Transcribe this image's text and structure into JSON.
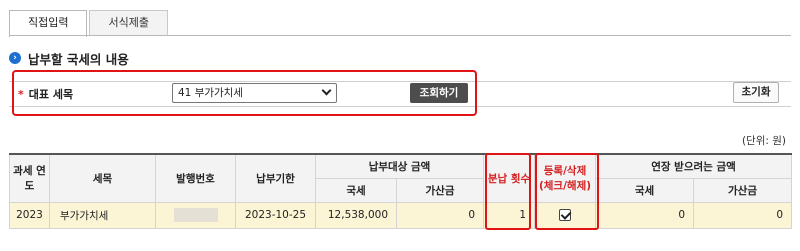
{
  "tabs": [
    {
      "label": "직접입력",
      "active": true
    },
    {
      "label": "서식제출",
      "active": false
    }
  ],
  "section_title": "납부할 국세의 내용",
  "search": {
    "required_mark": "*",
    "label": "대표 세목",
    "selected_value": "41 부가가치세",
    "query_button": "조회하기",
    "reset_button": "초기화"
  },
  "unit": "(단위: 원)",
  "table": {
    "headers": {
      "year": "과세 연도",
      "tax_item": "세목",
      "issue_no": "발행번호",
      "due_date": "납부기한",
      "target_amount": "납부대상 금액",
      "installments": "분납 횟수",
      "register_delete": "등록/삭제 (체크/해제)",
      "extension_amount": "연장 받으려는 금액",
      "national_tax": "국세",
      "additional_tax": "가산금",
      "ext_national_tax": "국세",
      "ext_additional_tax": "가산금"
    },
    "rows": [
      {
        "year": "2023",
        "tax_item": "부가가치세",
        "issue_no": "",
        "due_date": "2023-10-25",
        "national_tax": "12,538,000",
        "additional_tax": "0",
        "installments": "1",
        "checked": true,
        "ext_national_tax": "0",
        "ext_additional_tax": "0"
      }
    ]
  },
  "colors": {
    "highlight": "#e01414",
    "accent_blue": "#1f6fd0",
    "row_background": "#fbf5d6"
  }
}
